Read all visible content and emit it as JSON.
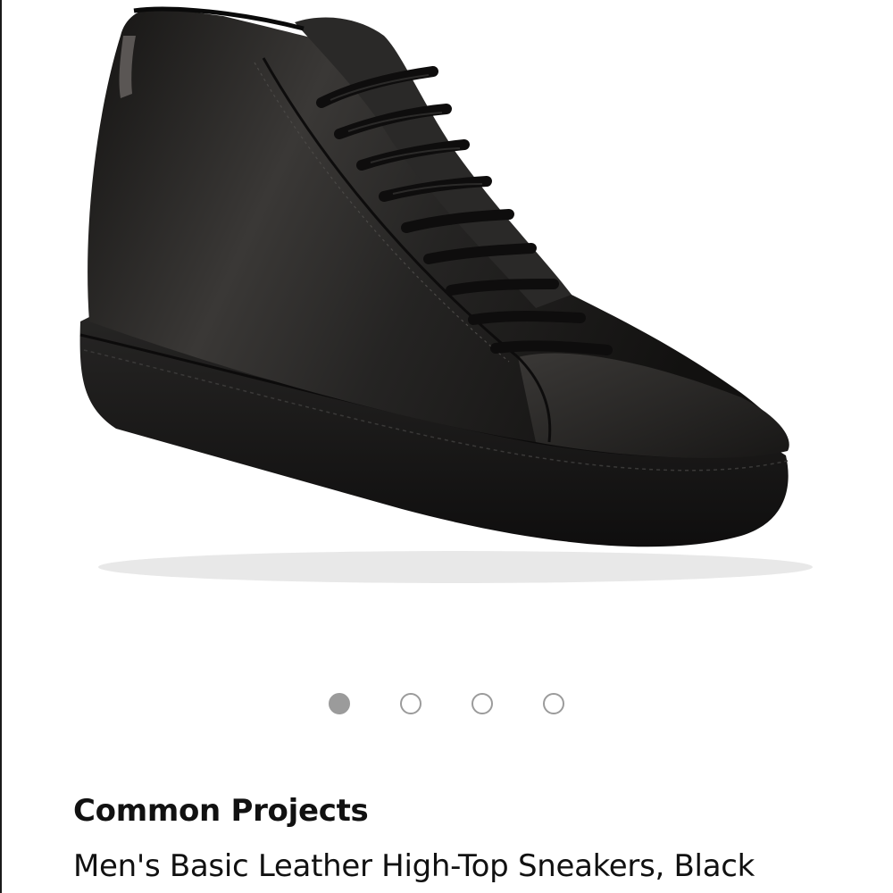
{
  "product": {
    "brand": "Common Projects",
    "title": "Men's Basic Leather High-Top Sneakers, Black",
    "image": {
      "description_icon": "sneaker-image",
      "color": "#1c1b1a"
    }
  },
  "carousel": {
    "total": 4,
    "active_index": 0
  },
  "colors": {
    "dot_active": "#9b9b9b",
    "dot_inactive_border": "#9b9b9b",
    "text": "#111111"
  }
}
